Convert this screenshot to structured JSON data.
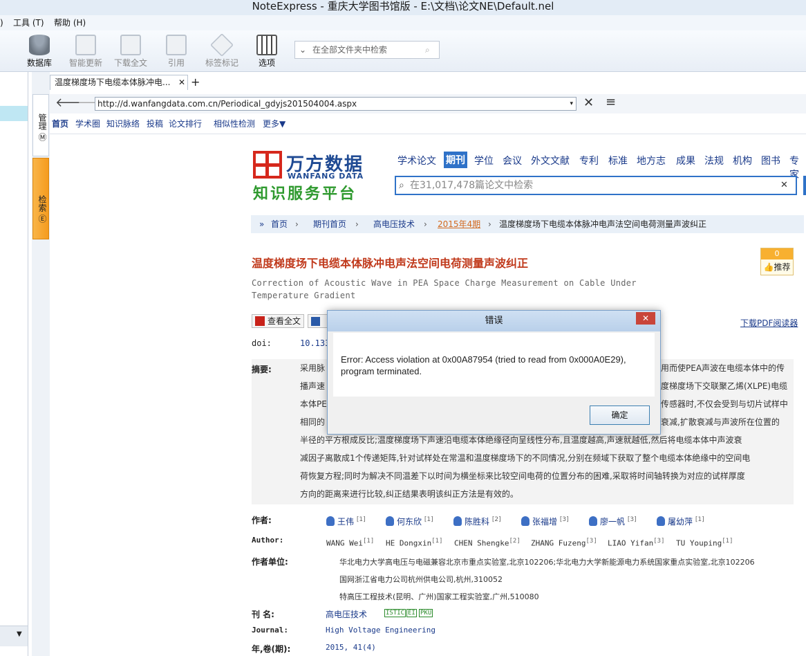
{
  "window": {
    "title": "NoteExpress - 重庆大学图书馆版 - E:\\文档\\论文NE\\Default.nel"
  },
  "menu": {
    "items": [
      "工具 (T)",
      "帮助 (H)"
    ]
  },
  "toolbar": {
    "buttons": [
      "数据库",
      "智能更新",
      "下载全文",
      "引用",
      "标签标记",
      "选项"
    ],
    "search_placeholder": "在全部文件夹中检索"
  },
  "side_tabs": {
    "manage": "管理",
    "search": "检索"
  },
  "browser": {
    "tab_title": "温度梯度场下电缆本体脉冲电...",
    "url": "http://d.wanfangdata.com.cn/Periodical_gdyjs201504004.aspx",
    "links": [
      "首页",
      "学术圈",
      "知识脉络",
      "投稿",
      "论文排行",
      "相似性检测",
      "更多▼"
    ]
  },
  "site": {
    "brand_cn": "万方数据",
    "brand_en": "WANFANG DATA",
    "slogan": "知识服务平台",
    "channels": [
      "学术论文",
      "期刊",
      "学位",
      "会议",
      "外文文献",
      "专利",
      "标准",
      "地方志",
      "成果",
      "法规",
      "机构",
      "图书",
      "专家"
    ],
    "search_placeholder": "在31,017,478篇论文中检索",
    "breadcrumb": [
      "首页",
      "期刊首页",
      "高电压技术",
      "2015年4期",
      "温度梯度场下电缆本体脉冲电声法空间电荷测量声波纠正"
    ]
  },
  "article": {
    "title_cn": "温度梯度场下电缆本体脉冲电声法空间电荷测量声波纠正",
    "title_en": "Correction of Acoustic Wave in PEA Space Charge Measurement on Cable Under Temperature Gradient",
    "like_count": "0",
    "like_label": "推荐",
    "view_fulltext": "查看全文",
    "download_reader": "下载PDF阅读器",
    "doi_label": "doi:",
    "doi_value": "10.133",
    "abstract_label": "摘要:",
    "abstract_lines": [
      "采用脉",
      "播声速",
      "本体PE",
      "相同的",
      "半径的平方根成反比;温度梯度场下声速沿电缆本体绝缘径向呈线性分布,且温度越高,声速就越低,然后将电缆本体中声波衰",
      "减因子离散成1个传递矩阵,针对试样处在常温和温度梯度场下的不同情况,分别在频域下获取了整个电缆本体绝缘中的空间电",
      "荷恢复方程;同时为解决不同温差下以时间为横坐标来比较空间电荷的位置分布的困难,采取将时间轴转换为对应的试样厚度",
      "方向的距离来进行比较,纠正结果表明该纠正方法是有效的。"
    ],
    "abstract_right": [
      "用而使PEA声波在电缆本体中的传",
      "度梯度场下交联聚乙烯(XLPE)电缆",
      "传感器时,不仅会受到与切片试样中",
      "衰减,扩散衰减与声波所在位置的"
    ],
    "authors_label": "作者:",
    "authors_cn": [
      "王伟",
      "何东欣",
      "陈胜科",
      "张福增",
      "廖一帆",
      "屠幼萍"
    ],
    "authors_sup": [
      "[1]",
      "[1]",
      "[2]",
      "[3]",
      "[3]",
      "[1]"
    ],
    "author_en_label": "Author:",
    "authors_en": [
      "WANG Wei",
      "HE Dongxin",
      "CHEN Shengke",
      "ZHANG Fuzeng",
      "LIAO Yifan",
      "TU Youping"
    ],
    "affil_label": "作者单位:",
    "affiliations": [
      "华北电力大学高电压与电磁兼容北京市重点实验室,北京102206;华北电力大学新能源电力系统国家重点实验室,北京102206",
      "国网浙江省电力公司杭州供电公司,杭州,310052",
      "特高压工程技术(昆明、广州)国家工程实验室,广州,510080"
    ],
    "journal_label": "刊 名:",
    "journal_cn": "高电压技术",
    "index_tags": [
      "ISTIC",
      "EI",
      "PKU"
    ],
    "journal_en_label": "Journal:",
    "journal_en": "High Voltage Engineering",
    "year_label": "年,卷(期):",
    "year_value": "2015, 41(4)"
  },
  "dialog": {
    "title": "错误",
    "close": "✕",
    "message": "Error: Access violation at 0x00A87954 (tried to read from 0x000A0E29), program terminated.",
    "ok": "确定"
  },
  "colors": {
    "brand_red": "#d6281c",
    "title_red": "#c0391b",
    "link_blue": "#1a3a8a",
    "active_channel": "#2f72c8"
  }
}
